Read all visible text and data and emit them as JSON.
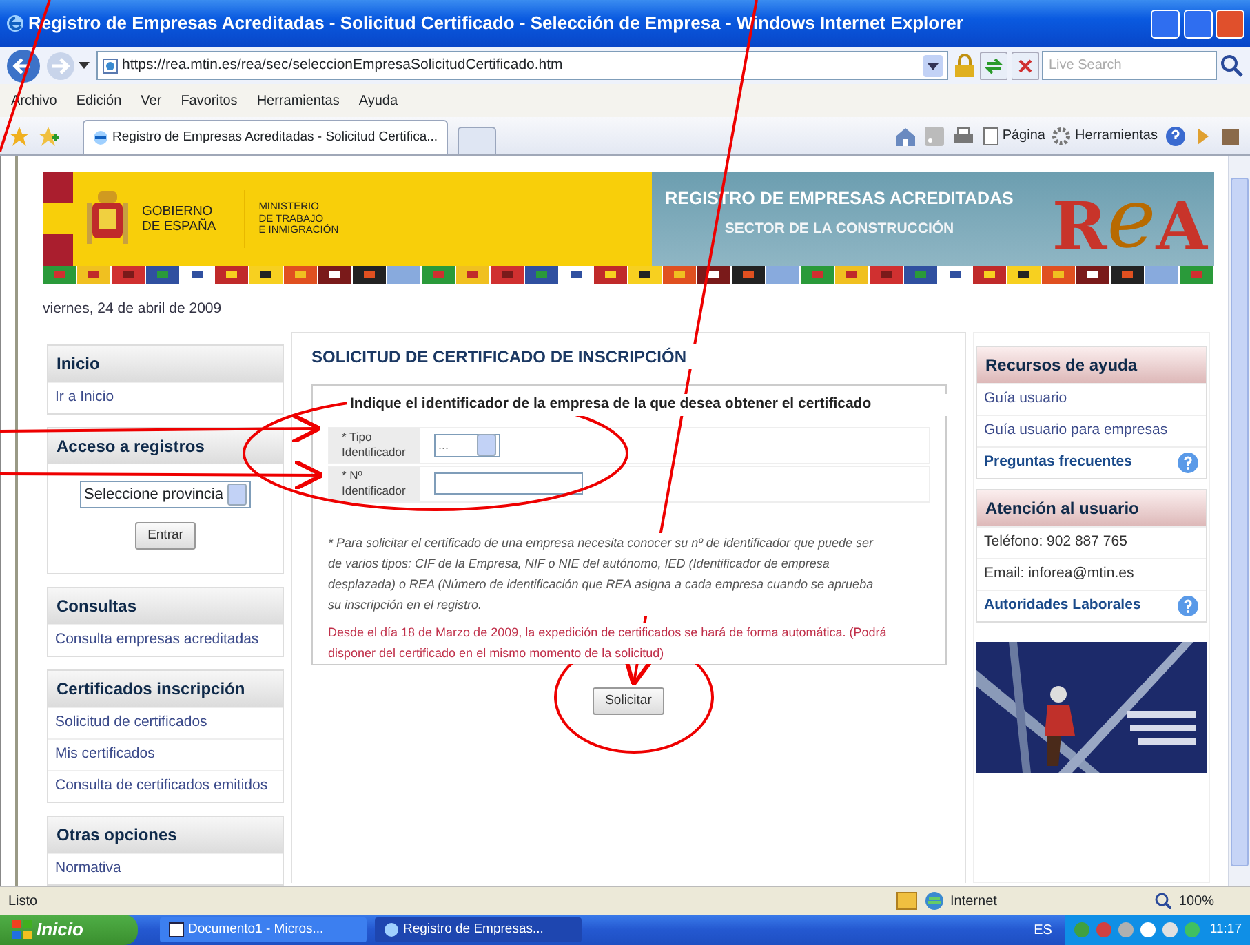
{
  "window": {
    "title": "Registro de Empresas Acreditadas - Solicitud Certificado - Selección de Empresa - Windows Internet Explorer"
  },
  "address_bar": {
    "url": "https://rea.mtin.es/rea/sec/seleccionEmpresaSolicitudCertificado.htm",
    "search_placeholder": "Live Search"
  },
  "menu": [
    "Archivo",
    "Edición",
    "Ver",
    "Favoritos",
    "Herramientas",
    "Ayuda"
  ],
  "tabs": [
    {
      "label": "Registro de Empresas Acreditadas - Solicitud Certifica...",
      "selected": true
    }
  ],
  "toolbar": [
    "Página",
    "Herramientas"
  ],
  "page": {
    "header": {
      "gov": [
        "GOBIERNO",
        "DE ESPAÑA"
      ],
      "ministry": [
        "MINISTERIO",
        "DE TRABAJO",
        "E INMIGRACIÓN"
      ],
      "title": "REGISTRO DE EMPRESAS ACREDITADAS",
      "subtitle": "SECTOR DE LA CONSTRUCCIÓN",
      "logo": [
        "R",
        "e",
        "A"
      ]
    },
    "date": "viernes, 24 de abril de 2009",
    "left_sidebar": [
      {
        "title": "Inicio",
        "kind": "links",
        "items": [
          "Ir a Inicio"
        ]
      },
      {
        "title": "Acceso a registros",
        "kind": "form",
        "select": "Seleccione provincia",
        "button": "Entrar"
      },
      {
        "title": "Consultas",
        "kind": "links",
        "items": [
          "Consulta empresas acreditadas"
        ]
      },
      {
        "title": "Certificados inscripción",
        "kind": "links",
        "items": [
          "Solicitud de certificados",
          "Mis certificados",
          "Consulta de certificados emitidos"
        ]
      },
      {
        "title": "Otras opciones",
        "kind": "links",
        "items": [
          "Normativa"
        ]
      }
    ],
    "main": {
      "title": "SOLICITUD DE CERTIFICADO DE INSCRIPCIÓN",
      "legend": "Indique el identificador de la empresa de la que desea obtener el certificado",
      "fields": [
        {
          "label": "* Tipo Identificador",
          "kind": "select",
          "value": "..."
        },
        {
          "label": "* Nº Identificador",
          "kind": "text"
        }
      ],
      "note": "* Para solicitar el certificado de una empresa necesita conocer su nº de identificador que puede ser de varios tipos: CIF de la Empresa, NIF o NIE del autónomo, IED (Identificador de empresa desplazada) o REA (Número de identificación que REA asigna a cada empresa cuando se aprueba su inscripción en el registro.",
      "notice": "Desde el día 18 de Marzo de 2009, la expedición de certificados se hará de forma automática. (Podrá disponer del certificado en el mismo momento de la solicitud)",
      "button": "Solicitar"
    },
    "right_sidebar": [
      {
        "title": "Recursos de ayuda",
        "items": [
          {
            "text": "Guía usuario",
            "kind": "link"
          },
          {
            "text": "Guía usuario para empresas",
            "kind": "link"
          },
          {
            "text": "Preguntas frecuentes",
            "kind": "help"
          }
        ]
      },
      {
        "title": "Atención al usuario",
        "items": [
          {
            "text": "Teléfono:  902 887 765",
            "kind": "info"
          },
          {
            "text": "Email: inforea@mtin.es",
            "kind": "info"
          },
          {
            "text": "Autoridades Laborales",
            "kind": "help"
          }
        ]
      }
    ]
  },
  "status_bar": {
    "text": "Listo",
    "zone": "Internet",
    "zoom": "100%"
  },
  "taskbar": {
    "start": "Inicio",
    "tasks": [
      {
        "label": "Documento1 - Micros...",
        "selected": false
      },
      {
        "label": "Registro de Empresas...",
        "selected": true
      }
    ],
    "language": "ES",
    "time": "11:17"
  }
}
